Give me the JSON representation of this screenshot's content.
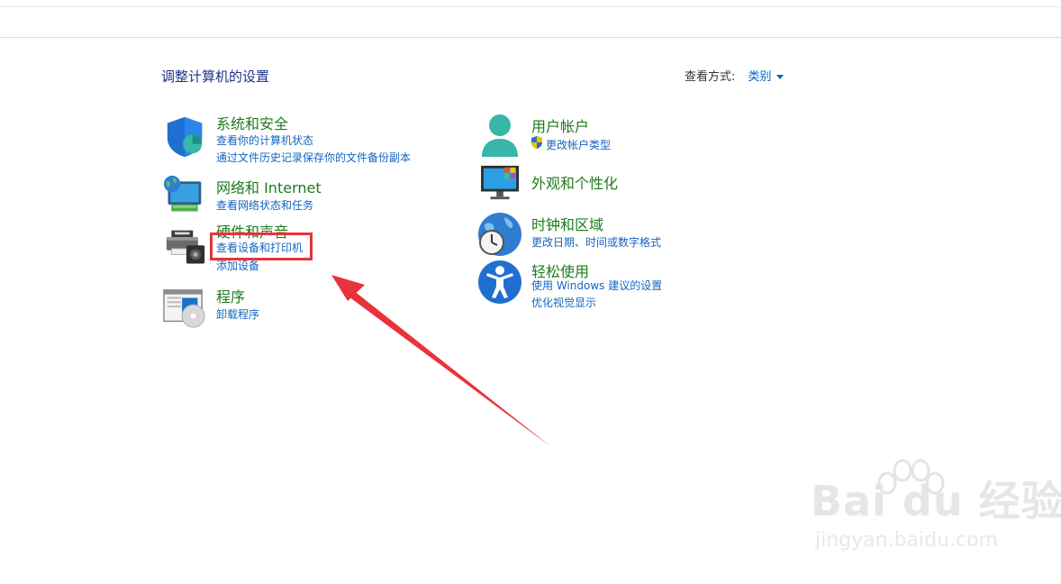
{
  "header": {
    "title": "调整计算机的设置",
    "view_by_label": "查看方式:",
    "view_by_value": "类别"
  },
  "left_categories": [
    {
      "title": "系统和安全",
      "links": [
        "查看你的计算机状态",
        "通过文件历史记录保存你的文件备份副本"
      ],
      "icon": "shield-icon"
    },
    {
      "title": "网络和 Internet",
      "links": [
        "查看网络状态和任务"
      ],
      "icon": "network-globe-icon"
    },
    {
      "title": "硬件和声音",
      "links": [
        "查看设备和打印机",
        "添加设备"
      ],
      "icon": "printer-icon"
    },
    {
      "title": "程序",
      "links": [
        "卸载程序"
      ],
      "icon": "programs-icon"
    }
  ],
  "right_categories": [
    {
      "title": "用户帐户",
      "links": [
        "更改帐户类型"
      ],
      "icon": "user-icon"
    },
    {
      "title": "外观和个性化",
      "links": [],
      "icon": "monitor-icon"
    },
    {
      "title": "时钟和区域",
      "links": [
        "更改日期、时间或数字格式"
      ],
      "icon": "clock-globe-icon"
    },
    {
      "title": "轻松使用",
      "links": [
        "使用 Windows 建议的设置",
        "优化视觉显示"
      ],
      "icon": "accessibility-icon"
    }
  ],
  "watermark": {
    "brand": "Bai du 经验",
    "url": "jingyan.baidu.com"
  },
  "colors": {
    "title": "#1e3287",
    "category": "#1e7a1e",
    "link": "#1565c0",
    "annotation": "#e8333a"
  }
}
